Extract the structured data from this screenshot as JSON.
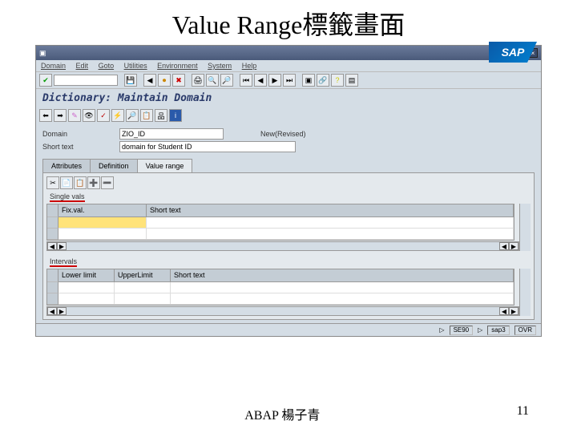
{
  "slide": {
    "title": "Value Range標籤畫面"
  },
  "menubar": [
    "Domain",
    "Edit",
    "Goto",
    "Utilities",
    "Environment",
    "System",
    "Help"
  ],
  "screen": {
    "title": "Dictionary: Maintain Domain"
  },
  "fields": {
    "domain_label": "Domain",
    "domain_value": "ZIO_ID",
    "status": "New(Revised)",
    "shorttext_label": "Short text",
    "shorttext_value": "domain for Student ID"
  },
  "tabs": {
    "t1": "Attributes",
    "t2": "Definition",
    "t3": "Value range"
  },
  "sections": {
    "single_vals": "Single vals",
    "intervals": "Intervals"
  },
  "grid1": {
    "col1": "Fix.val.",
    "col2": "Short text"
  },
  "grid2": {
    "col1": "Lower limit",
    "col2": "UpperLimit",
    "col3": "Short text"
  },
  "statusbar": {
    "c1": "SE90",
    "c2": "sap3",
    "c3": "OVR"
  },
  "footer": {
    "author": "ABAP 楊子青",
    "page": "11"
  },
  "logo": "SAP"
}
